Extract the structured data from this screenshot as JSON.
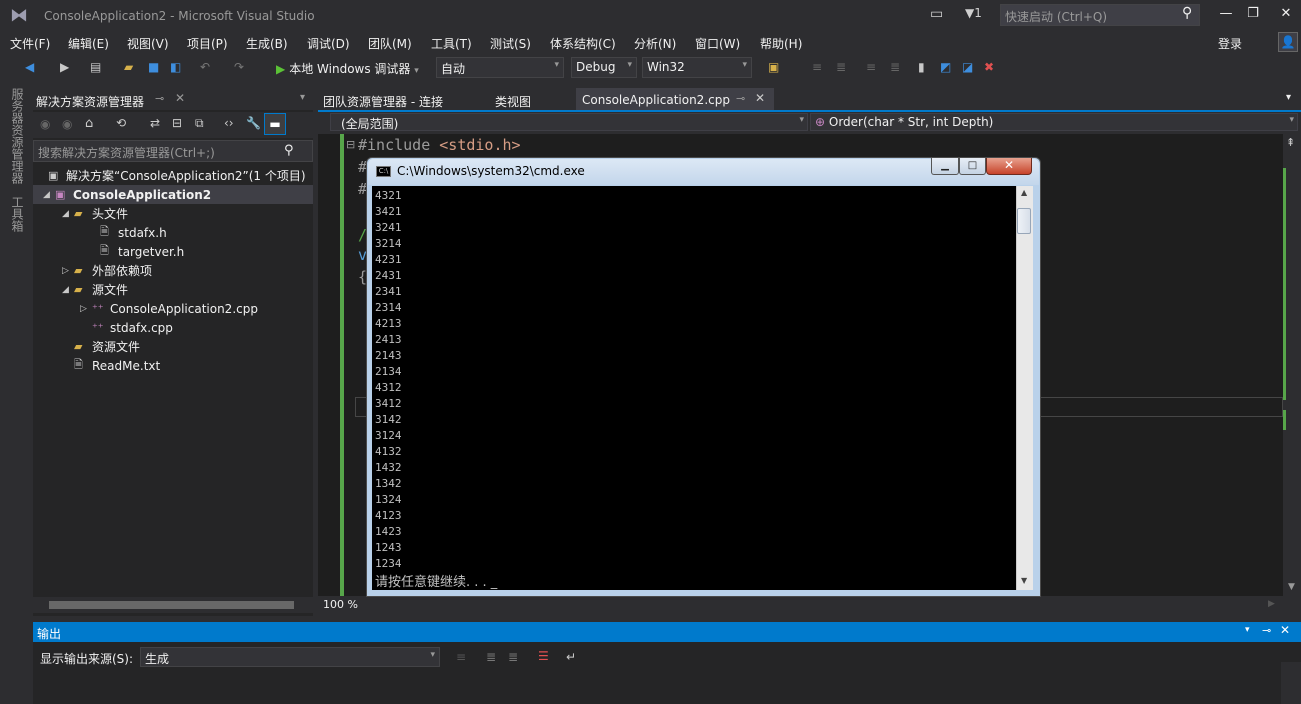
{
  "window": {
    "title": "ConsoleApplication2 - Microsoft Visual Studio",
    "filter_count": "1",
    "quick_launch_placeholder": "快速启动 (Ctrl+Q)",
    "login": "登录"
  },
  "menu": [
    "文件(F)",
    "编辑(E)",
    "视图(V)",
    "项目(P)",
    "生成(B)",
    "调试(D)",
    "团队(M)",
    "工具(T)",
    "测试(S)",
    "体系结构(C)",
    "分析(N)",
    "窗口(W)",
    "帮助(H)"
  ],
  "toolbar": {
    "run_label": "本地 Windows 调试器",
    "run_mode": "自动",
    "configuration": "Debug",
    "platform": "Win32"
  },
  "left_strip": {
    "server_explorer": "服务器资源管理器",
    "toolbox": "工具箱"
  },
  "solution_explorer": {
    "title": "解决方案资源管理器",
    "search_placeholder": "搜索解决方案资源管理器(Ctrl+;)",
    "items": [
      {
        "label": "解决方案“ConsoleApplication2”(1 个项目)"
      },
      {
        "label": "ConsoleApplication2"
      },
      {
        "label": "头文件"
      },
      {
        "label": "stdafx.h"
      },
      {
        "label": "targetver.h"
      },
      {
        "label": "外部依赖项"
      },
      {
        "label": "源文件"
      },
      {
        "label": "ConsoleApplication2.cpp"
      },
      {
        "label": "stdafx.cpp"
      },
      {
        "label": "资源文件"
      },
      {
        "label": "ReadMe.txt"
      }
    ]
  },
  "doc_tabs": {
    "team_explorer": "团队资源管理器 - 连接",
    "class_view": "类视图",
    "active": "ConsoleApplication2.cpp"
  },
  "nav_bar": {
    "scope": "(全局范围)",
    "member": "Order(char * Str, int Depth)"
  },
  "editor": {
    "line1_directive": "#include",
    "line1_header": "<stdio.h>",
    "zoom": "100 %"
  },
  "cmd": {
    "title": "C:\\Windows\\system32\\cmd.exe",
    "lines": [
      "4321",
      "3421",
      "3241",
      "3214",
      "4231",
      "2431",
      "2341",
      "2314",
      "4213",
      "2413",
      "2143",
      "2134",
      "4312",
      "3412",
      "3142",
      "3124",
      "4132",
      "1432",
      "1342",
      "1324",
      "4123",
      "1423",
      "1243",
      "1234"
    ],
    "prompt": "请按任意键继续. . . _"
  },
  "output": {
    "title": "输出",
    "source_label": "显示输出来源(S):",
    "source_value": "生成"
  }
}
